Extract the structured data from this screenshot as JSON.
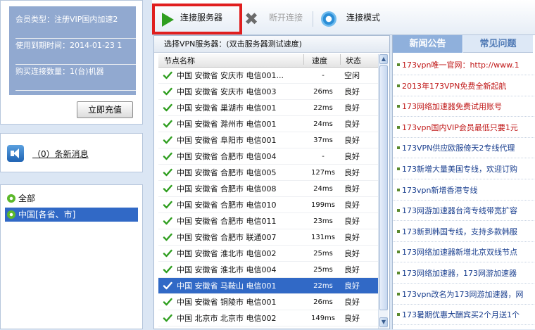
{
  "account": {
    "member_type": "会员类型：注册VIP国内加速2",
    "expiry": "使用到期时间：2014-01-23 1",
    "connections": "购买连接数量：1(台)机器",
    "recharge_label": "立即充值"
  },
  "messages": {
    "label": "（0）条新消息"
  },
  "regions": [
    "全部",
    "中国[各省、市]"
  ],
  "toolbar": {
    "connect_label": "连接服务器",
    "disconnect_label": "断开连接",
    "mode_label": "连接模式"
  },
  "server_list": {
    "caption": "选择VPN服务器：(双击服务器测试速度)",
    "headers": {
      "name": "节点名称",
      "speed": "速度",
      "state": "状态"
    },
    "rows": [
      {
        "name": "中国 安徽省 安庆市 电信001...",
        "speed": "-",
        "state": "空闲"
      },
      {
        "name": "中国 安徽省 安庆市 电信003",
        "speed": "26ms",
        "state": "良好"
      },
      {
        "name": "中国 安徽省 巢湖市 电信001",
        "speed": "22ms",
        "state": "良好"
      },
      {
        "name": "中国 安徽省 滁州市 电信001",
        "speed": "24ms",
        "state": "良好"
      },
      {
        "name": "中国 安徽省 阜阳市 电信001",
        "speed": "37ms",
        "state": "良好"
      },
      {
        "name": "中国 安徽省 合肥市 电信004",
        "speed": "-",
        "state": "良好"
      },
      {
        "name": "中国 安徽省 合肥市 电信005",
        "speed": "127ms",
        "state": "良好"
      },
      {
        "name": "中国 安徽省 合肥市 电信008",
        "speed": "24ms",
        "state": "良好"
      },
      {
        "name": "中国 安徽省 合肥市 电信010",
        "speed": "199ms",
        "state": "良好"
      },
      {
        "name": "中国 安徽省 合肥市 电信011",
        "speed": "23ms",
        "state": "良好"
      },
      {
        "name": "中国 安徽省 合肥市 联通007",
        "speed": "131ms",
        "state": "良好"
      },
      {
        "name": "中国 安徽省 淮北市 电信002",
        "speed": "25ms",
        "state": "良好"
      },
      {
        "name": "中国 安徽省 淮北市 电信004",
        "speed": "25ms",
        "state": "良好"
      },
      {
        "name": "中国 安徽省 马鞍山 电信001",
        "speed": "22ms",
        "state": "良好"
      },
      {
        "name": "中国 安徽省 铜陵市 电信001",
        "speed": "26ms",
        "state": "良好"
      },
      {
        "name": "中国 北京市 北京市 电信002",
        "speed": "149ms",
        "state": "良好"
      }
    ],
    "selected_row": 13
  },
  "news": {
    "tabs": [
      "新闻公告",
      "常见问题"
    ],
    "items": [
      {
        "text": "173vpn唯一官网：http://www.1",
        "color": "red"
      },
      {
        "text": "2013年173VPN免费全新起航",
        "color": "red"
      },
      {
        "text": "173网络加速器免费试用账号",
        "color": "red"
      },
      {
        "text": "173vpn国内VIP会员最低只要1元",
        "color": "red"
      },
      {
        "text": "173VPN供应欧服倚天2专线代理",
        "color": "blue"
      },
      {
        "text": "173新增大量美国专线，欢迎订购",
        "color": "blue"
      },
      {
        "text": "173vpn新增香港专线",
        "color": "blue"
      },
      {
        "text": "173网游加速器台湾专线带宽扩容",
        "color": "blue"
      },
      {
        "text": "173新到韩国专线，支持多款韩服",
        "color": "blue"
      },
      {
        "text": "173网络加速器新增北京双线节点",
        "color": "blue"
      },
      {
        "text": "173网络加速器，173网游加速器",
        "color": "blue"
      },
      {
        "text": "173vpn改名为173网游加速器，网",
        "color": "blue"
      },
      {
        "text": "173暑期优惠大酬宾买2个月送1个",
        "color": "blue"
      }
    ]
  },
  "colors": {
    "accent": "#3169c6",
    "highlight": "#e01e1e",
    "ok": "#2f9e1f"
  }
}
